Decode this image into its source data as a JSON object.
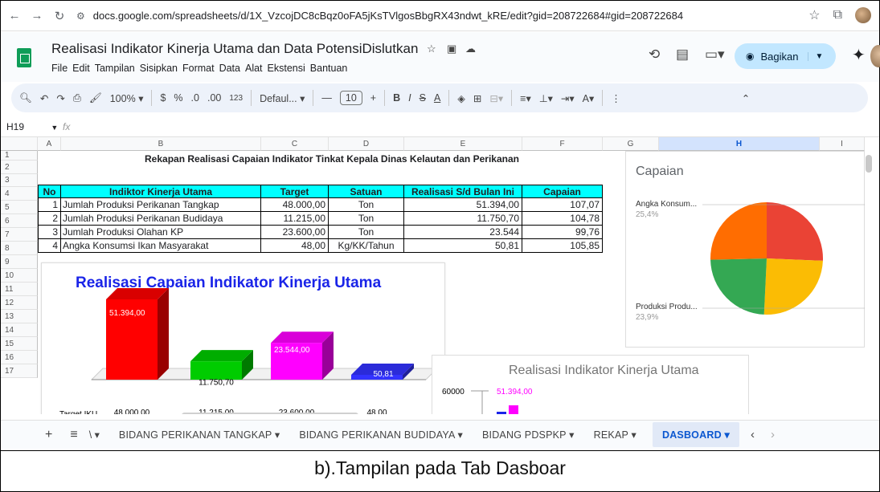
{
  "browser": {
    "url": "docs.google.com/spreadsheets/d/1X_VzcojDC8cBqz0oFA5jKsTVlgosBbgRX43ndwt_kRE/edit?gid=208722684#gid=208722684"
  },
  "app": {
    "title": "Realisasi Indikator Kinerja Utama dan Data PotensiDislutkan",
    "menu": [
      "File",
      "Edit",
      "Tampilan",
      "Sisipkan",
      "Format",
      "Data",
      "Alat",
      "Ekstensi",
      "Bantuan"
    ],
    "share_label": "Bagikan"
  },
  "toolbar": {
    "zoom": "100%",
    "currency": "$",
    "percent": "%",
    "dec_dec": ".0",
    "dec_inc": ".00",
    "format_num": "123",
    "font": "Defaul...",
    "font_size": "10",
    "bold": "B",
    "italic": "I",
    "strike": "S",
    "textcolor": "A"
  },
  "formula_bar": {
    "cell_ref": "H19",
    "fx": "fx",
    "value": ""
  },
  "columns": [
    "A",
    "B",
    "C",
    "D",
    "E",
    "F",
    "G",
    "H",
    "I"
  ],
  "rows": [
    "1",
    "2",
    "3",
    "4",
    "5",
    "6",
    "7",
    "8",
    "9",
    "10",
    "11",
    "12",
    "13",
    "14",
    "15",
    "16",
    "17"
  ],
  "sheet": {
    "title": "Rekapan Realisasi Capaian Indikator Tinkat Kepala Dinas Kelautan dan Perikanan",
    "headers": [
      "No",
      "Indiktor Kinerja Utama",
      "Target",
      "Satuan",
      "Realisasi S/d Bulan Ini",
      "Capaian"
    ],
    "rows": [
      [
        "1",
        "Jumlah Produksi Perikanan Tangkap",
        "48.000,00",
        "Ton",
        "51.394,00",
        "107,07"
      ],
      [
        "2",
        "Jumlah Produksi Perikanan Budidaya",
        "11.215,00",
        "Ton",
        "11.750,70",
        "104,78"
      ],
      [
        "3",
        "Jumlah Produksi Olahan KP",
        "23.600,00",
        "Ton",
        "23.544",
        "99,76"
      ],
      [
        "4",
        "Angka Konsumsi Ikan Masyarakat",
        "48,00",
        "Kg/KK/Tahun",
        "50,81",
        "105,85"
      ]
    ]
  },
  "chart_data": [
    {
      "type": "bar",
      "title": "Realisasi Capaian Indikator Kinerja Utama",
      "categories": [
        "Jumlah Produksi Perikanan Tangkap",
        "Jumlah Produksi Perikanan Budidaya",
        "Jumlah Produksi Olahan KP",
        "Angka Konsumsi Ikan Masyarakat"
      ],
      "series": [
        {
          "name": "",
          "values": [
            51394.0,
            11750.7,
            23544.0,
            50.81
          ],
          "labels": [
            "51.394,00",
            "11.750,70",
            "23.544,00",
            "50,81"
          ],
          "colors": [
            "#ff0000",
            "#00cc00",
            "#ff00ff",
            "#3333ff"
          ]
        }
      ],
      "table_row": {
        "label": "Target IKU",
        "values": [
          "48.000,00",
          "11.215,00",
          "23.600,00",
          "48,00"
        ]
      },
      "style": "3d"
    },
    {
      "type": "bar",
      "title": "Realisasi Indikator Kinerja Utama",
      "y_tick": "60000",
      "data_label": "51.394,00",
      "bar_colors": [
        "#1a24e8",
        "#ff00ff"
      ]
    },
    {
      "type": "pie",
      "title": "Capaian",
      "slices": [
        {
          "label": "Produksi Perikanan Tangkap",
          "value": 107.07,
          "color": "#ea4335"
        },
        {
          "label": "Produksi Perikanan Budidaya",
          "value": 104.78,
          "color": "#fbbc04"
        },
        {
          "label": "Produksi Olahan KP",
          "value": 99.76,
          "color": "#34a853"
        },
        {
          "label": "Angka Konsumsi Ikan Masyarakat",
          "value": 105.85,
          "color": "#ff6d01"
        }
      ],
      "legend_labels": [
        {
          "text": "Angka Konsum...",
          "pct": "25,4%"
        },
        {
          "text": "Produksi Produ...",
          "pct": "23,9%"
        }
      ]
    }
  ],
  "tabs": {
    "items": [
      "BIDANG PERIKANAN TANGKAP",
      "BIDANG PERIKANAN BUDIDAYA",
      "BIDANG PDSPKP",
      "REKAP",
      "DASBOARD"
    ],
    "active": "DASBOARD"
  },
  "caption": "b).Tampilan pada Tab Dasboar"
}
